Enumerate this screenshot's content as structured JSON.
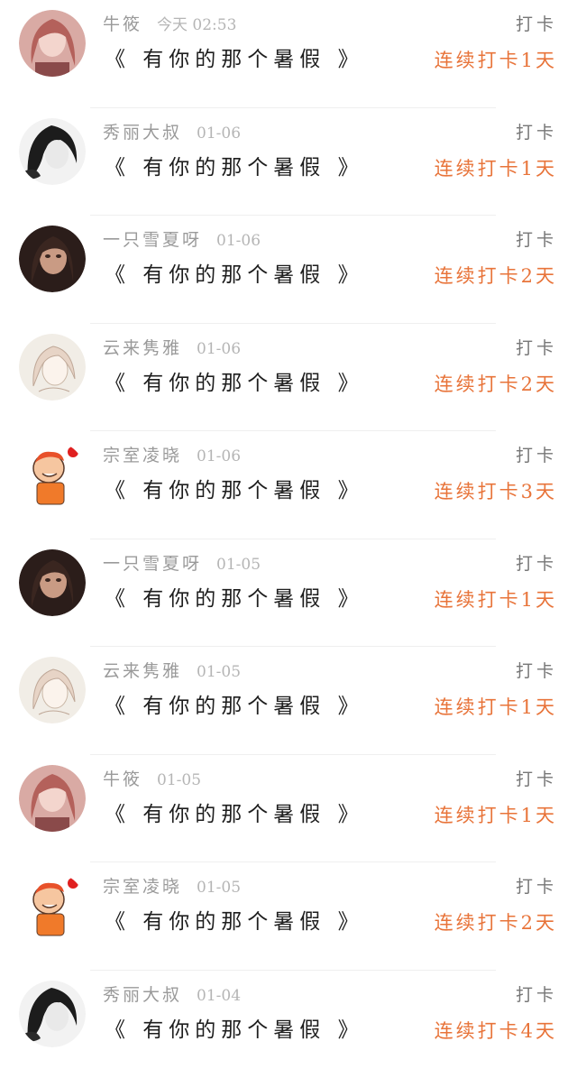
{
  "checkin_feed": {
    "action_label": "打卡",
    "items": [
      {
        "user": "牛筱",
        "time": "今天 02:53",
        "book": "《 有你的那个暑假 》",
        "streak": "连续打卡1天",
        "avatar": "pink-girl-avatar"
      },
      {
        "user": "秀丽大叔",
        "time": "01-06",
        "book": "《 有你的那个暑假 》",
        "streak": "连续打卡1天",
        "avatar": "bw-girl-avatar"
      },
      {
        "user": "一只雪夏呀",
        "time": "01-06",
        "book": "《 有你的那个暑假 》",
        "streak": "连续打卡2天",
        "avatar": "dark-girl-avatar"
      },
      {
        "user": "云来隽雅",
        "time": "01-06",
        "book": "《 有你的那个暑假 》",
        "streak": "连续打卡2天",
        "avatar": "sketch-girl-avatar"
      },
      {
        "user": "宗室凌晓",
        "time": "01-06",
        "book": "《 有你的那个暑假 》",
        "streak": "连续打卡3天",
        "avatar": "cartoon-player-avatar"
      },
      {
        "user": "一只雪夏呀",
        "time": "01-05",
        "book": "《 有你的那个暑假 》",
        "streak": "连续打卡1天",
        "avatar": "dark-girl-avatar"
      },
      {
        "user": "云来隽雅",
        "time": "01-05",
        "book": "《 有你的那个暑假 》",
        "streak": "连续打卡1天",
        "avatar": "sketch-girl-avatar"
      },
      {
        "user": "牛筱",
        "time": "01-05",
        "book": "《 有你的那个暑假 》",
        "streak": "连续打卡1天",
        "avatar": "pink-girl-avatar"
      },
      {
        "user": "宗室凌晓",
        "time": "01-05",
        "book": "《 有你的那个暑假 》",
        "streak": "连续打卡2天",
        "avatar": "cartoon-player-avatar"
      },
      {
        "user": "秀丽大叔",
        "time": "01-04",
        "book": "《 有你的那个暑假 》",
        "streak": "连续打卡4天",
        "avatar": "bw-girl-avatar"
      }
    ]
  },
  "colors": {
    "streak": "#e8743a",
    "name": "#9a9a9a",
    "title": "#1e1e1e",
    "divider": "#efefef"
  }
}
